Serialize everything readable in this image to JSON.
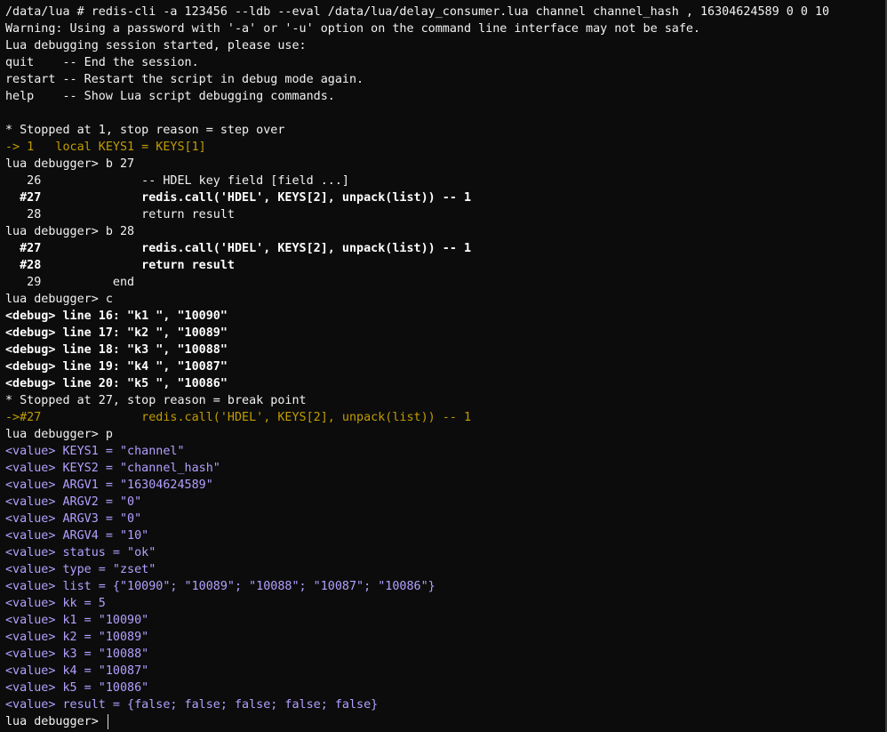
{
  "colors": {
    "background": "#0c0c0c",
    "text": "#f2f2f2",
    "bold_text": "#ffffff",
    "orange": "#c19c00",
    "purple": "#b4a0ff"
  },
  "terminal": {
    "lines": [
      {
        "text": "/data/lua # redis-cli -a 123456 --ldb --eval /data/lua/delay_consumer.lua channel channel_hash , 16304624589 0 0 10",
        "style": "normal"
      },
      {
        "text": "Warning: Using a password with '-a' or '-u' option on the command line interface may not be safe.",
        "style": "normal"
      },
      {
        "text": "Lua debugging session started, please use:",
        "style": "normal"
      },
      {
        "text": "quit    -- End the session.",
        "style": "normal"
      },
      {
        "text": "restart -- Restart the script in debug mode again.",
        "style": "normal"
      },
      {
        "text": "help    -- Show Lua script debugging commands.",
        "style": "normal"
      },
      {
        "text": "",
        "style": "normal"
      },
      {
        "text": "* Stopped at 1, stop reason = step over",
        "style": "normal"
      },
      {
        "text": "-> 1   local KEYS1 = KEYS[1]",
        "style": "orange"
      },
      {
        "text": "lua debugger> b 27",
        "style": "normal"
      },
      {
        "text": "   26              -- HDEL key field [field ...]",
        "style": "normal"
      },
      {
        "text": "  #27              redis.call('HDEL', KEYS[2], unpack(list)) -- 1",
        "style": "bold"
      },
      {
        "text": "   28              return result",
        "style": "normal"
      },
      {
        "text": "lua debugger> b 28",
        "style": "normal"
      },
      {
        "text": "  #27              redis.call('HDEL', KEYS[2], unpack(list)) -- 1",
        "style": "bold"
      },
      {
        "text": "  #28              return result",
        "style": "bold"
      },
      {
        "text": "   29          end",
        "style": "normal"
      },
      {
        "text": "lua debugger> c",
        "style": "normal"
      },
      {
        "text": "<debug> line 16: \"k1 \", \"10090\"",
        "style": "bold"
      },
      {
        "text": "<debug> line 17: \"k2 \", \"10089\"",
        "style": "bold"
      },
      {
        "text": "<debug> line 18: \"k3 \", \"10088\"",
        "style": "bold"
      },
      {
        "text": "<debug> line 19: \"k4 \", \"10087\"",
        "style": "bold"
      },
      {
        "text": "<debug> line 20: \"k5 \", \"10086\"",
        "style": "bold"
      },
      {
        "text": "* Stopped at 27, stop reason = break point",
        "style": "normal"
      },
      {
        "text": "->#27              redis.call('HDEL', KEYS[2], unpack(list)) -- 1",
        "style": "orange"
      },
      {
        "text": "lua debugger> p",
        "style": "normal"
      },
      {
        "text": "<value> KEYS1 = \"channel\"",
        "style": "purple"
      },
      {
        "text": "<value> KEYS2 = \"channel_hash\"",
        "style": "purple"
      },
      {
        "text": "<value> ARGV1 = \"16304624589\"",
        "style": "purple"
      },
      {
        "text": "<value> ARGV2 = \"0\"",
        "style": "purple"
      },
      {
        "text": "<value> ARGV3 = \"0\"",
        "style": "purple"
      },
      {
        "text": "<value> ARGV4 = \"10\"",
        "style": "purple"
      },
      {
        "text": "<value> status = \"ok\"",
        "style": "purple"
      },
      {
        "text": "<value> type = \"zset\"",
        "style": "purple"
      },
      {
        "text": "<value> list = {\"10090\"; \"10089\"; \"10088\"; \"10087\"; \"10086\"}",
        "style": "purple"
      },
      {
        "text": "<value> kk = 5",
        "style": "purple"
      },
      {
        "text": "<value> k1 = \"10090\"",
        "style": "purple"
      },
      {
        "text": "<value> k2 = \"10089\"",
        "style": "purple"
      },
      {
        "text": "<value> k3 = \"10088\"",
        "style": "purple"
      },
      {
        "text": "<value> k4 = \"10087\"",
        "style": "purple"
      },
      {
        "text": "<value> k5 = \"10086\"",
        "style": "purple"
      },
      {
        "text": "<value> result = {false; false; false; false; false}",
        "style": "purple"
      }
    ],
    "prompt": "lua debugger> "
  }
}
